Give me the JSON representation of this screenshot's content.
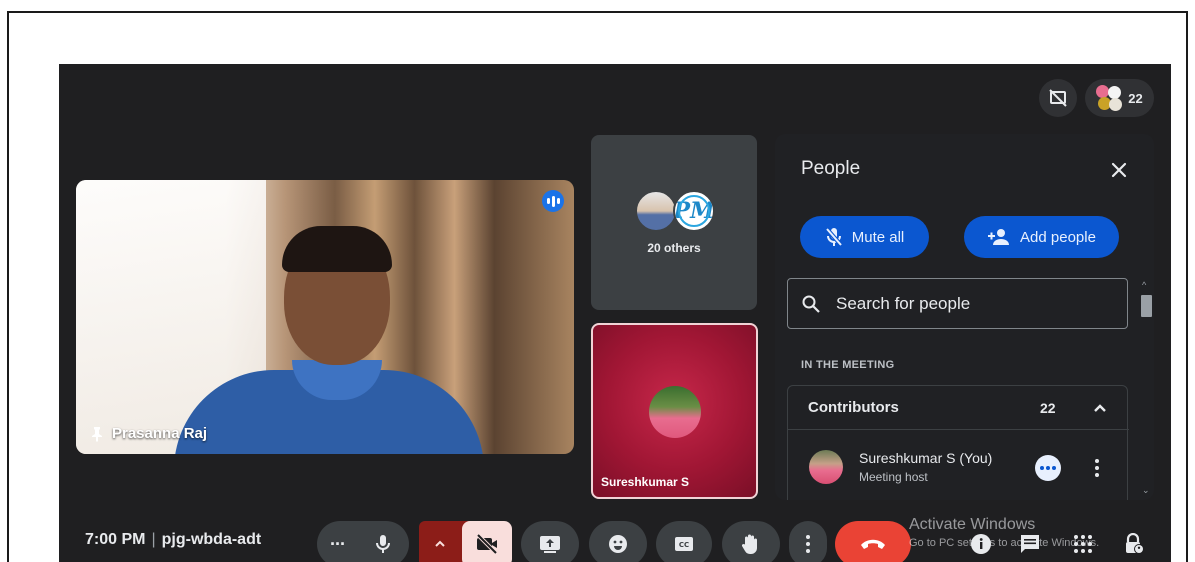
{
  "topbar": {
    "participant_count": "22"
  },
  "main_tile": {
    "name": "Prasanna Raj"
  },
  "others_tile": {
    "label": "20 others",
    "avatar_initials": "PM"
  },
  "self_tile": {
    "name": "Sureshkumar S"
  },
  "people_panel": {
    "title": "People",
    "mute_all_label": "Mute all",
    "add_people_label": "Add people",
    "search_placeholder": "Search for people",
    "section_label": "IN THE MEETING",
    "contributors_label": "Contributors",
    "contributors_count": "22",
    "participant": {
      "name": "Sureshkumar S (You)",
      "role": "Meeting host"
    }
  },
  "bottombar": {
    "time": "7:00 PM",
    "meeting_code": "pjg-wbda-adt"
  },
  "watermark": {
    "line1": "Activate Windows",
    "line2": "Go to PC settings to activate Windows."
  },
  "colors": {
    "background": "#1f1f21",
    "panel": "#202124",
    "accent_blue": "#0b57d0",
    "leave_red": "#ea4335",
    "camera_off_red": "#8c1d18"
  }
}
